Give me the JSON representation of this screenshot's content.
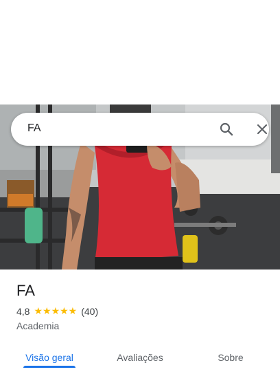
{
  "search": {
    "query": "FA"
  },
  "icons": {
    "search": "search-icon",
    "close": "close-icon",
    "star": "star-icon"
  },
  "place": {
    "name": "FA",
    "rating": "4,8",
    "stars": "★★★★★",
    "review_count": "(40)",
    "category": "Academia"
  },
  "tabs": [
    {
      "label": "Visão geral",
      "active": true
    },
    {
      "label": "Avaliações",
      "active": false
    },
    {
      "label": "Sobre",
      "active": false
    }
  ],
  "colors": {
    "accent": "#1a73e8",
    "star": "#fbbc04",
    "shirt": "#d62a35"
  }
}
